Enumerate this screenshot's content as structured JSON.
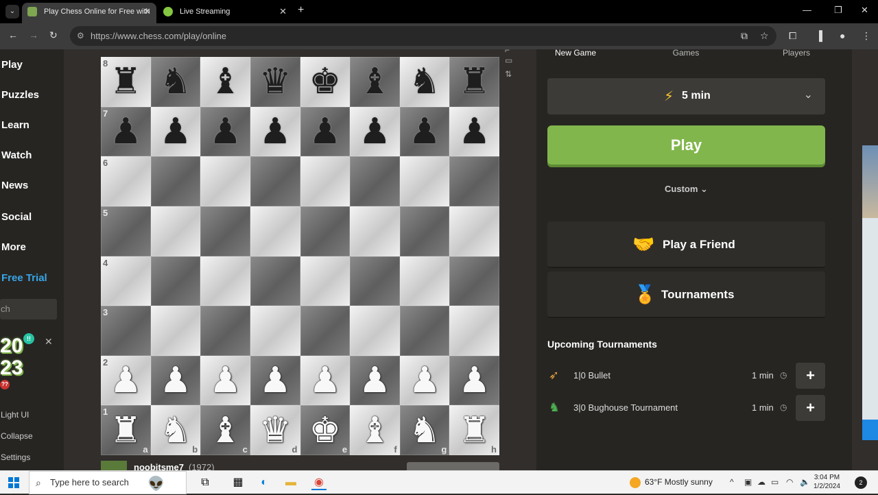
{
  "browser": {
    "tabs": [
      {
        "title": "Play Chess Online for Free with",
        "active": true,
        "icon": "chess-pawn-favicon"
      },
      {
        "title": "Live Streaming",
        "active": false,
        "icon": "rumble-play-favicon"
      }
    ],
    "url": "https://www.chess.com/play/online"
  },
  "sidebar": {
    "items": [
      "Play",
      "Puzzles",
      "Learn",
      "Watch",
      "News",
      "Social",
      "More",
      "Free Trial"
    ],
    "search_placeholder": "ch",
    "badge_text_top": "20",
    "badge_text_bottom": "23",
    "footer": [
      "Light UI",
      "Collapse",
      "Settings"
    ]
  },
  "board": {
    "ranks": [
      "8",
      "7",
      "6",
      "5",
      "4",
      "3",
      "2",
      "1"
    ],
    "files": [
      "a",
      "b",
      "c",
      "d",
      "e",
      "f",
      "g",
      "h"
    ],
    "position": [
      [
        "br",
        "bn",
        "bb",
        "bq",
        "bk",
        "bb",
        "bn",
        "br"
      ],
      [
        "bp",
        "bp",
        "bp",
        "bp",
        "bp",
        "bp",
        "bp",
        "bp"
      ],
      [
        "",
        "",
        "",
        "",
        "",
        "",
        "",
        ""
      ],
      [
        "",
        "",
        "",
        "",
        "",
        "",
        "",
        ""
      ],
      [
        "",
        "",
        "",
        "",
        "",
        "",
        "",
        ""
      ],
      [
        "",
        "",
        "",
        "",
        "",
        "",
        "",
        ""
      ],
      [
        "wp",
        "wp",
        "wp",
        "wp",
        "wp",
        "wp",
        "wp",
        "wp"
      ],
      [
        "wr",
        "wn",
        "wb",
        "wq",
        "wk",
        "wb",
        "wn",
        "wr"
      ]
    ]
  },
  "player": {
    "name": "noobitsme7",
    "rating": "(1972)"
  },
  "panel": {
    "tabs": [
      "New Game",
      "Games",
      "Players"
    ],
    "time_control": "5 min",
    "play_label": "Play",
    "custom_label": "Custom",
    "play_friend_label": "Play a Friend",
    "tournaments_label": "Tournaments",
    "upcoming_title": "Upcoming Tournaments",
    "tournaments": [
      {
        "name": "1|0 Bullet",
        "time": "1 min",
        "icon": "bullet-icon"
      },
      {
        "name": "3|0 Bughouse Tournament",
        "time": "1 min",
        "icon": "bughouse-icon"
      }
    ],
    "accent": "#81b64c"
  },
  "taskbar": {
    "search_placeholder": "Type here to search",
    "weather": "63°F  Mostly sunny",
    "time": "3:04 PM",
    "date": "1/2/2024",
    "notifications": "2"
  }
}
